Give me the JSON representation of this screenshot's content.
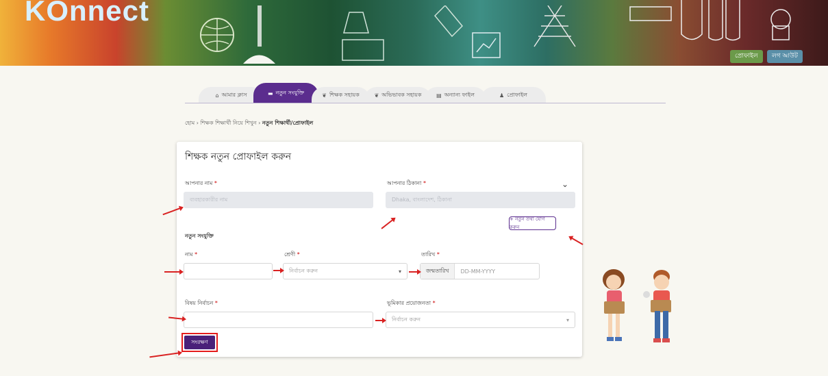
{
  "banner": {
    "logo": "KOnnect",
    "buttons": [
      "প্রোফাইল",
      "লগ আউট"
    ]
  },
  "tabs": [
    {
      "icon": "home-icon",
      "glyph": "⌂",
      "label": "আমার ক্লাস"
    },
    {
      "icon": "book-icon",
      "glyph": "▬",
      "label": "নতুন সংযুক্তি"
    },
    {
      "icon": "leaf-icon",
      "glyph": "❦",
      "label": "শিক্ষক সহায়ক"
    },
    {
      "icon": "leaf-icon",
      "glyph": "❦",
      "label": "অভিভাবক সহায়ক"
    },
    {
      "icon": "doc-icon",
      "glyph": "▤",
      "label": "অন্যান্য ফাইল"
    },
    {
      "icon": "user-icon",
      "glyph": "♟",
      "label": "প্রোফাইল"
    }
  ],
  "breadcrumb": {
    "items": [
      "হোম",
      "শিক্ষক শিক্ষার্থী নিয়ে শিখুন"
    ],
    "current": "নতুন শিক্ষার্থী/প্রোফাইল"
  },
  "form": {
    "title": "শিক্ষক নতুন প্রোফাইল করুন",
    "field1": {
      "label": "আপনার নাম",
      "value": "ব্যবহারকারীর নাম"
    },
    "field2": {
      "label": "আপনার ঠিকানা",
      "value": "Dhaka, বাংলাদেশ, ঠিকানা"
    },
    "add_button": "+ নতুন তথ্য যোগ করুন",
    "section_label": "নতুন সংযুক্তি",
    "name": {
      "label": "নাম",
      "value": ""
    },
    "category": {
      "label": "শ্রেণী",
      "placeholder": "নির্বাচন করুন"
    },
    "date": {
      "label": "তারিখ",
      "prefix": "জন্মতারিখ",
      "placeholder": "DD-MM-YYYY"
    },
    "subject": {
      "label": "বিষয় নির্বাচন",
      "value": ""
    },
    "need": {
      "label": "ভূমিকার প্রয়োজনতা",
      "placeholder": "নির্বাচন করুন"
    },
    "save_button": "সংরক্ষণ"
  }
}
